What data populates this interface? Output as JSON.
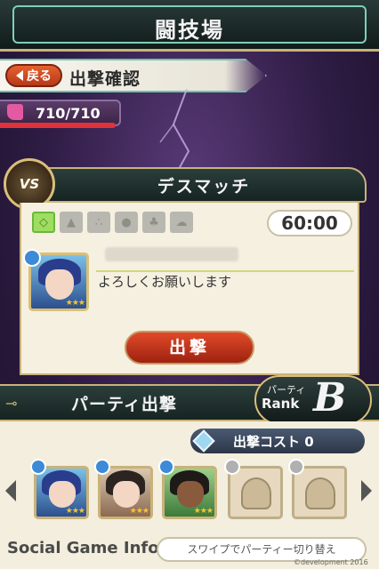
{
  "header": {
    "title": "闘技場"
  },
  "nav": {
    "back_label": "戻る",
    "subtitle": "出撃確認"
  },
  "stamina": {
    "text": "710/710",
    "fraction": 1.0
  },
  "match": {
    "title": "デスマッチ",
    "vs_label": "VS",
    "timer": "60:00",
    "environment_icons": [
      "grass-icon",
      "mountain-icon",
      "rocks-icon",
      "water-drop-icon",
      "forest-icon",
      "cloud-icon"
    ],
    "opponent_message": "よろしくお願いします",
    "opponent_stars": "★★★",
    "sortie_label": "出撃"
  },
  "party": {
    "title": "パーティ出撃",
    "rank_label_top": "パーティ",
    "rank_label_bottom": "Rank",
    "rank_value": "B",
    "cost_label": "出撃コスト 0",
    "slot_stars": [
      "★★★",
      "★★★",
      "★★★"
    ],
    "swipe_hint": "スワイプでパーティー切り替え"
  },
  "footer": {
    "watermark": "Social Game Info",
    "copyright": "©development 2016"
  },
  "colors": {
    "accent_gold": "#c9b27a",
    "teal_border": "#6fc3ac",
    "sortie_red": "#e04a2a",
    "stamina_red": "#e0323a"
  }
}
